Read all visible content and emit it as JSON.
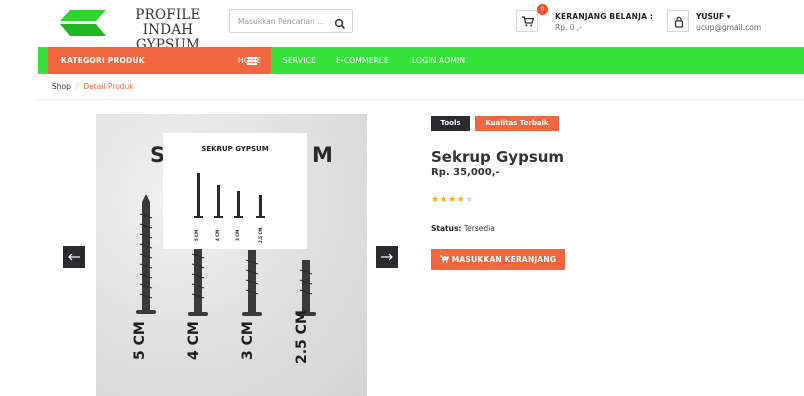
{
  "header": {
    "logo_line1": "PROFILE INDAH",
    "logo_line2": "GYPSUM",
    "search_placeholder": "Masukkan Pencarian ...",
    "cart": {
      "count": "0",
      "title": "KERANJANG BELANJA :",
      "amount": "Rp. 0 ,-"
    },
    "user": {
      "name": "YUSUF ▾",
      "email": "ucup@gmail.com"
    }
  },
  "nav": {
    "category_label": "KATEGORI PRODUK",
    "links": [
      "HOME",
      "SERVICE",
      "E-COMMERCE",
      "LOGIN ADMIN"
    ]
  },
  "breadcrumb": {
    "root": "Shop",
    "separator": "/",
    "current": "Detail Produk"
  },
  "product": {
    "tags": [
      "Tools",
      "Kualitas Terbaik"
    ],
    "name": "Sekrup Gypsum",
    "price": "Rp. 35,000,-",
    "rating": 4,
    "rating_max": 5,
    "status_label": "Status:",
    "status_value": "Tersedia",
    "add_to_cart_label": "MASUKKAN KERANJANG",
    "image": {
      "title_left": "S",
      "title_right": "M",
      "inset_title": "SEKRUP GYPSUM",
      "size_labels": [
        "5 CM",
        "4 CM",
        "3 CM",
        "2.5 CM"
      ]
    }
  },
  "colors": {
    "accent": "#f0673f",
    "nav_green": "#35e23a",
    "dark": "#2a2b2f",
    "star": "#f0b418"
  },
  "icons": [
    "cart-icon",
    "user-icon",
    "search-icon",
    "menu-icon",
    "arrow-left-icon",
    "arrow-right-icon"
  ]
}
